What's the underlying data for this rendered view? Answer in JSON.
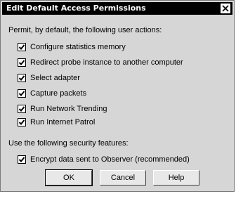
{
  "dialog": {
    "title": "Edit Default Access Permissions",
    "close_glyph": "✕"
  },
  "permissions": {
    "heading": "Permit, by default,  the following user actions:",
    "options": [
      {
        "label": "Configure statistics memory",
        "checked": true
      },
      {
        "label": "Redirect probe instance to another computer",
        "checked": true
      },
      {
        "label": "Select adapter",
        "checked": true
      },
      {
        "label": "Capture packets",
        "checked": true
      },
      {
        "label": "Run Network Trending",
        "checked": true
      },
      {
        "label": "Run Internet Patrol",
        "checked": true
      }
    ]
  },
  "security": {
    "heading": "Use the following security features:",
    "options": [
      {
        "label": "Encrypt data sent to Observer (recommended)",
        "checked": true
      }
    ]
  },
  "buttons": {
    "ok": "OK",
    "cancel": "Cancel",
    "help": "Help"
  }
}
